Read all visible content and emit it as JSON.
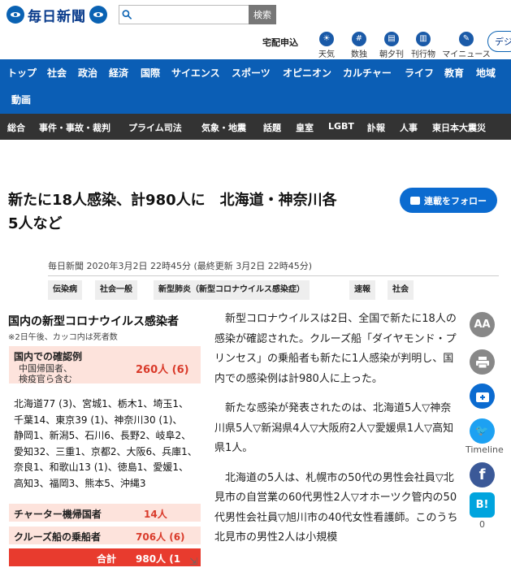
{
  "header": {
    "logo_text": "毎日新聞",
    "search_placeholder": "",
    "search_button": "検索",
    "takuhai": "宅配申込",
    "utilities": [
      {
        "label": "天気",
        "icon": "weather-icon"
      },
      {
        "label": "数独",
        "icon": "sudoku-icon"
      },
      {
        "label": "朝夕刊",
        "icon": "newspaper-icon"
      },
      {
        "label": "刊行物",
        "icon": "book-icon"
      },
      {
        "label": "マイニュース",
        "icon": "mynews-icon"
      }
    ],
    "digital_label": "デジ"
  },
  "nav_main": [
    "トップ",
    "社会",
    "政治",
    "経済",
    "国際",
    "サイエンス",
    "スポーツ",
    "オピニオン",
    "カルチャー",
    "ライフ",
    "教育",
    "地域",
    "動画"
  ],
  "nav_sub": [
    "総合",
    "事件・事故・裁判",
    "プライム司法",
    "気象・地震",
    "話題",
    "皇室",
    "LGBT",
    "訃報",
    "人事",
    "東日本大震災"
  ],
  "article": {
    "title_line1": "新たに18人感染、計980人に　北海道・神奈川各",
    "title_line2": "5人など",
    "follow_label": "連載をフォロー",
    "meta": "毎日新聞 2020年3月2日 22時45分 (最終更新 3月2日 22時45分)",
    "tags": [
      "伝染病",
      "社会一般",
      "新型肺炎（新型コロナウイルス感染症）",
      "速報",
      "社会"
    ],
    "paragraphs": [
      "新型コロナウイルスは2日、全国で新たに18人の感染が確認された。クルーズ船「ダイヤモンド・プリンセス」の乗船者も新たに1人感染が判明し、国内での感染例は計980人に上った。",
      "新たな感染が発表されたのは、北海道5人▽神奈川県5人▽新潟県4人▽大阪府2人▽愛媛県1人▽高知県1人。",
      "北海道の5人は、札幌市の50代の男性会社員▽北見市の自営業の60代男性2人▽オホーツク管内の50代男性会社員▽旭川市の40代女性看護師。このうち北見市の男性2人は小規模"
    ]
  },
  "infobox": {
    "heading": "国内の新型コロナウイルス感染者",
    "note": "※2日午後、カッコ内は死者数",
    "domestic_label": "国内での確認例",
    "domestic_sub1": "中国帰国者、",
    "domestic_sub2": "検疫官ら含む",
    "domestic_value": "260人 (6)",
    "pref_lines": [
      "北海道77 (3)、宮城1、栃木1、埼玉1、",
      "千葉14、東京39 (1)、神奈川30 (1)、",
      "静岡1、新潟5、石川6、長野2、岐阜2、",
      "愛知32、三重1、京都2、大阪6、兵庫1、",
      "奈良1、和歌山13 (1)、徳島1、愛媛1、",
      "高知3、福岡3、熊本5、沖縄3"
    ],
    "charter_label": "チャーター機帰国者",
    "charter_value": "14人",
    "cruise_label": "クルーズ船の乗船者",
    "cruise_value": "706人 (6)",
    "total_label": "合計",
    "total_value": "980人 (1"
  },
  "share": {
    "font_size_label": "AA",
    "twitter_label": "Timeline",
    "hatena_label": "B!",
    "hatena_count": "0"
  },
  "colors": {
    "brand_blue": "#0b5eb5",
    "subnav_dark": "#333333",
    "accent_red": "#e83b2e",
    "box_pink": "#fde3dc"
  }
}
